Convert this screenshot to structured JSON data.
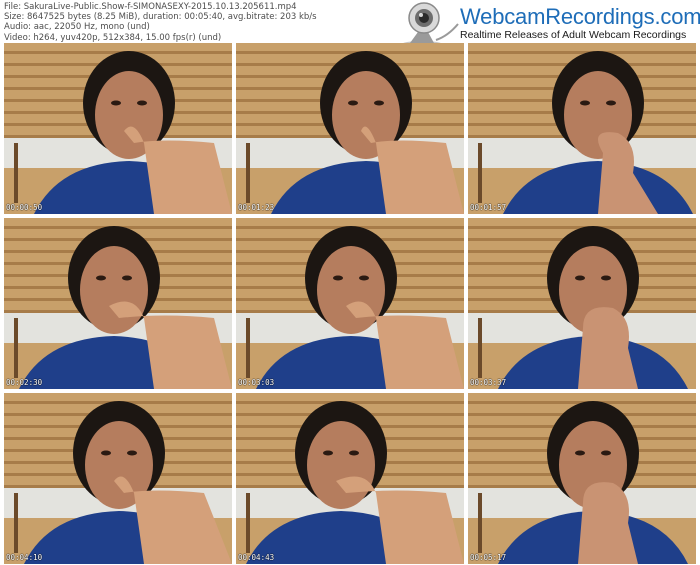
{
  "meta": {
    "file": "File: SakuraLive-Public.Show-f-SIMONASEXY-2015.10.13.205611.mp4",
    "size": "Size: 8647525 bytes (8.25 MiB), duration: 00:05:40, avg.bitrate: 203 kb/s",
    "audio": "Audio: aac, 22050 Hz, mono (und)",
    "video": "Video: h264, yuv420p, 512x384, 15.00 fps(r) (und)"
  },
  "logo": {
    "brand": "WebcamRecordings.com",
    "tagline": "Realtime Releases of Adult Webcam Recordings",
    "icon": "webcam-icon",
    "brand_color": "#1e6db8"
  },
  "thumbnails": [
    {
      "timestamp": "00:00:50"
    },
    {
      "timestamp": "00:01:23"
    },
    {
      "timestamp": "00:01:57"
    },
    {
      "timestamp": "00:02:30"
    },
    {
      "timestamp": "00:03:03"
    },
    {
      "timestamp": "00:03:37"
    },
    {
      "timestamp": "00:04:10"
    },
    {
      "timestamp": "00:04:43"
    },
    {
      "timestamp": "00:05:17"
    }
  ]
}
